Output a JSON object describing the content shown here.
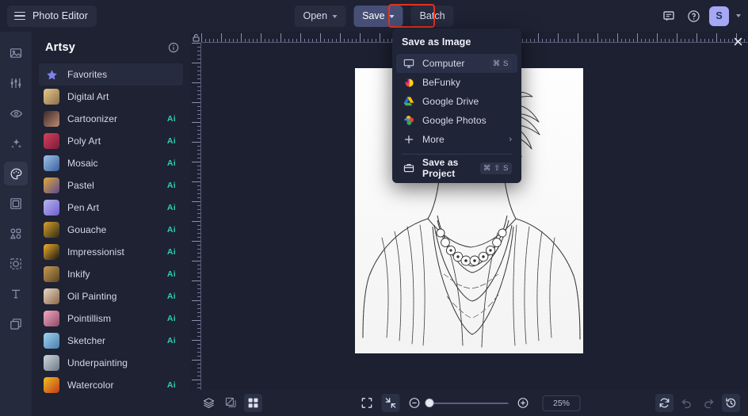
{
  "app": {
    "brand_label": "Photo Editor",
    "accent_purple": "#474f77",
    "highlight_red": "#e8311a",
    "ai_badge_color": "#2ecfb0",
    "avatar_bg": "#a4a8f5"
  },
  "toolbar": {
    "open_label": "Open",
    "save_label": "Save",
    "batch_label": "Batch",
    "avatar_initial": "S",
    "feedback_icon": "comment-icon",
    "help_icon": "question-circle-icon",
    "account_caret_icon": "chevron-down-icon"
  },
  "rail": {
    "items": [
      {
        "name": "image-icon",
        "selected": false
      },
      {
        "name": "adjust-sliders-icon",
        "selected": false
      },
      {
        "name": "retouch-eye-icon",
        "selected": false
      },
      {
        "name": "effects-sparkle-icon",
        "selected": false
      },
      {
        "name": "artsy-palette-icon",
        "selected": true
      },
      {
        "name": "frames-icon",
        "selected": false
      },
      {
        "name": "graphics-shapes-icon",
        "selected": false
      },
      {
        "name": "overlays-icon",
        "selected": false
      },
      {
        "name": "text-icon",
        "selected": false
      },
      {
        "name": "layers-copy-icon",
        "selected": false
      }
    ]
  },
  "panel": {
    "title": "Artsy",
    "info_icon": "info-circle-icon",
    "items": [
      {
        "label": "Favorites",
        "ai": "",
        "icon": "star-icon",
        "c1": "#7b83ef",
        "c2": "#5a63d8",
        "selected": true
      },
      {
        "label": "Digital Art",
        "ai": "",
        "icon": "thumb",
        "c1": "#e8c98a",
        "c2": "#8a6f4a",
        "selected": false
      },
      {
        "label": "Cartoonizer",
        "ai": "Ai",
        "icon": "thumb",
        "c1": "#3a2a28",
        "c2": "#c08a74",
        "selected": false
      },
      {
        "label": "Poly Art",
        "ai": "Ai",
        "icon": "thumb",
        "c1": "#d6405f",
        "c2": "#7a1c38",
        "selected": false
      },
      {
        "label": "Mosaic",
        "ai": "Ai",
        "icon": "thumb",
        "c1": "#9fc3e8",
        "c2": "#3a5f9e",
        "selected": false
      },
      {
        "label": "Pastel",
        "ai": "Ai",
        "icon": "thumb",
        "c1": "#e0a93c",
        "c2": "#5b4a8e",
        "selected": false
      },
      {
        "label": "Pen Art",
        "ai": "Ai",
        "icon": "thumb",
        "c1": "#b9b6ee",
        "c2": "#6d5fd0",
        "selected": false
      },
      {
        "label": "Gouache",
        "ai": "Ai",
        "icon": "thumb",
        "c1": "#d8a22a",
        "c2": "#2e2a18",
        "selected": false
      },
      {
        "label": "Impressionist",
        "ai": "Ai",
        "icon": "thumb",
        "c1": "#f0b02a",
        "c2": "#141414",
        "selected": false
      },
      {
        "label": "Inkify",
        "ai": "Ai",
        "icon": "thumb",
        "c1": "#c79c55",
        "c2": "#5a4322",
        "selected": false
      },
      {
        "label": "Oil Painting",
        "ai": "Ai",
        "icon": "thumb",
        "c1": "#e8d9c3",
        "c2": "#8a6747",
        "selected": false
      },
      {
        "label": "Pointillism",
        "ai": "Ai",
        "icon": "thumb",
        "c1": "#f2a9c0",
        "c2": "#8e4a66",
        "selected": false
      },
      {
        "label": "Sketcher",
        "ai": "Ai",
        "icon": "thumb",
        "c1": "#9fd2f0",
        "c2": "#4a7fae",
        "selected": false
      },
      {
        "label": "Underpainting",
        "ai": "",
        "icon": "thumb",
        "c1": "#cfd6dc",
        "c2": "#6d7a86",
        "selected": false
      },
      {
        "label": "Watercolor",
        "ai": "Ai",
        "icon": "thumb",
        "c1": "#f2c01e",
        "c2": "#c03a1e",
        "selected": false
      }
    ]
  },
  "save_menu": {
    "title": "Save as Image",
    "items": [
      {
        "label": "Computer",
        "icon": "monitor-icon",
        "shortcut": "⌘ S",
        "arrow": "",
        "bold": false,
        "hover": true
      },
      {
        "label": "BeFunky",
        "icon": "befunky-logo-icon",
        "shortcut": "",
        "arrow": "",
        "bold": false,
        "hover": false
      },
      {
        "label": "Google Drive",
        "icon": "google-drive-icon",
        "shortcut": "",
        "arrow": "",
        "bold": false,
        "hover": false
      },
      {
        "label": "Google Photos",
        "icon": "google-photos-icon",
        "shortcut": "",
        "arrow": "",
        "bold": false,
        "hover": false
      },
      {
        "label": "More",
        "icon": "plus-icon",
        "shortcut": "",
        "arrow": "›",
        "bold": false,
        "hover": false
      }
    ],
    "project_item": {
      "label": "Save as Project",
      "icon": "project-save-icon",
      "shortcut": "⌘ ⇧ S",
      "bold": true
    }
  },
  "canvas": {
    "close_icon": "close-icon",
    "ruler_lock_icon": "lock-icon",
    "artwork_alt": "pencil-sketch-portrait-woman-with-necklaces"
  },
  "bottombar": {
    "left_tools": [
      {
        "name": "layers-icon",
        "selected": false
      },
      {
        "name": "compare-icon",
        "selected": false
      },
      {
        "name": "grid-view-icon",
        "selected": true
      }
    ],
    "fit_icon": "fit-to-screen-icon",
    "actual_icon": "shrink-to-fit-icon",
    "zoom_out_icon": "minus-circle-icon",
    "zoom_in_icon": "plus-circle-icon",
    "zoom_value": "25%",
    "zoom_slider_position": 0,
    "right_tools": [
      {
        "name": "reset-icon",
        "selected": true,
        "disabled": false
      },
      {
        "name": "undo-icon",
        "selected": false,
        "disabled": true
      },
      {
        "name": "redo-icon",
        "selected": false,
        "disabled": true
      },
      {
        "name": "history-icon",
        "selected": true,
        "disabled": false
      }
    ]
  }
}
